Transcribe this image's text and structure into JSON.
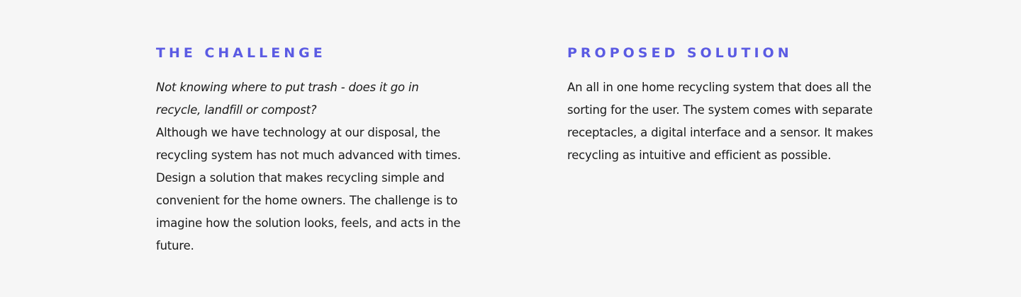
{
  "challenge": {
    "heading": "THE CHALLENGE",
    "lead": "Not knowing where to put trash - does it go in recycle, landfill or compost?",
    "body": "Although we have technology at our disposal, the recycling system has not much advanced with times. Design a solution that makes recycling simple and convenient for the home owners. The challenge is to imagine how the solution looks, feels, and acts in the future."
  },
  "solution": {
    "heading": "PROPOSED SOLUTION",
    "body": "An all in one home recycling system that does all the sorting for the user. The system comes with separate receptacles, a digital interface and a sensor. It makes recycling as intuitive and efficient as possible."
  },
  "colors": {
    "accent": "#5b5be3",
    "background": "#f6f6f6",
    "text": "#1a1a1a"
  }
}
